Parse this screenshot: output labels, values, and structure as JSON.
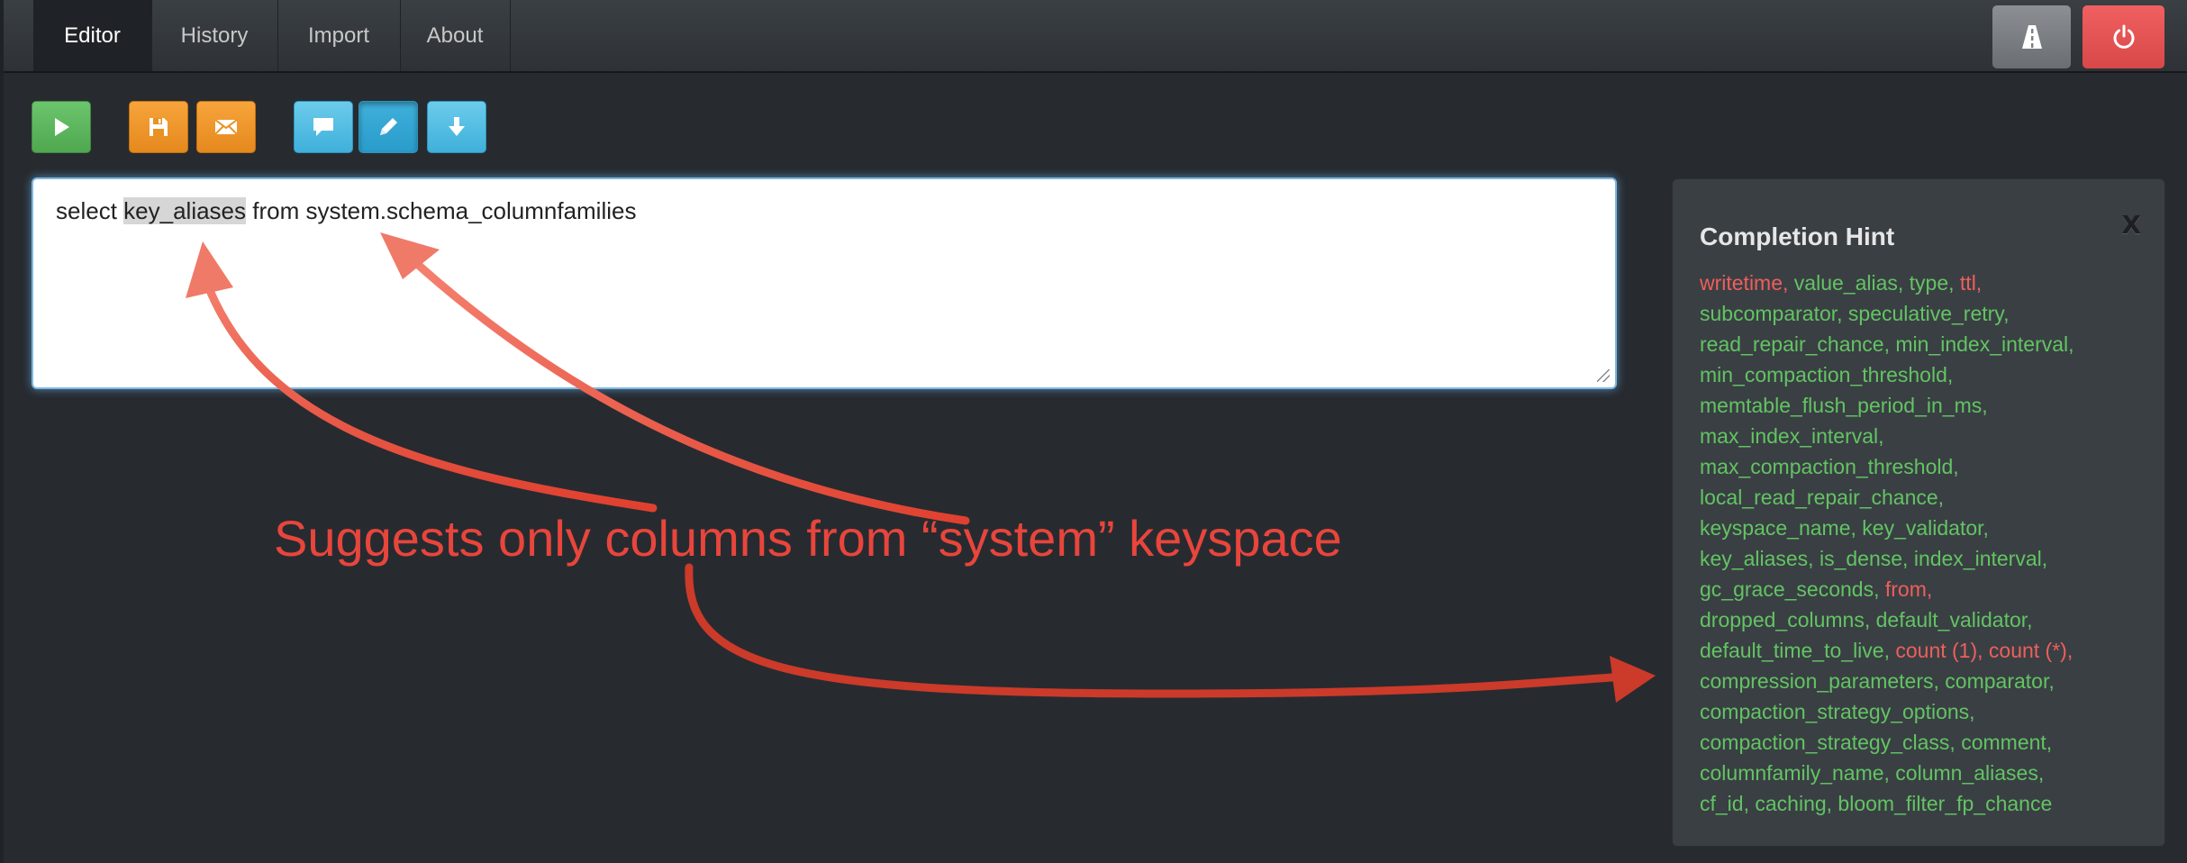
{
  "nav": {
    "tabs": [
      "Editor",
      "History",
      "Import",
      "About"
    ],
    "active_tab": "Editor"
  },
  "toolbar": {
    "buttons": [
      {
        "name": "run",
        "icon": "play-icon",
        "color": "green"
      },
      {
        "name": "save",
        "icon": "save-icon",
        "color": "orange"
      },
      {
        "name": "mail",
        "icon": "envelope-icon",
        "color": "orange"
      },
      {
        "name": "comment",
        "icon": "comment-icon",
        "color": "blue"
      },
      {
        "name": "edit",
        "icon": "pencil-icon",
        "color": "blue",
        "active": true
      },
      {
        "name": "download",
        "icon": "arrow-down-icon",
        "color": "blue"
      }
    ]
  },
  "editor": {
    "before": "select ",
    "highlight": "key_aliases",
    "after": " from system.schema_columnfamilies"
  },
  "completion": {
    "title": "Completion Hint",
    "close": "X",
    "lines": [
      [
        {
          "t": "writetime,",
          "k": true
        },
        {
          "t": " value_alias,",
          "k": false
        },
        {
          "t": " type,",
          "k": false
        },
        {
          "t": " ttl,",
          "k": true
        }
      ],
      [
        {
          "t": "subcomparator,",
          "k": false
        },
        {
          "t": " speculative_retry,",
          "k": false
        }
      ],
      [
        {
          "t": "read_repair_chance,",
          "k": false
        },
        {
          "t": " min_index_interval,",
          "k": false
        }
      ],
      [
        {
          "t": "min_compaction_threshold,",
          "k": false
        }
      ],
      [
        {
          "t": "memtable_flush_period_in_ms,",
          "k": false
        }
      ],
      [
        {
          "t": "max_index_interval,",
          "k": false
        }
      ],
      [
        {
          "t": "max_compaction_threshold,",
          "k": false
        }
      ],
      [
        {
          "t": "local_read_repair_chance,",
          "k": false
        }
      ],
      [
        {
          "t": "keyspace_name,",
          "k": false
        },
        {
          "t": " key_validator,",
          "k": false
        }
      ],
      [
        {
          "t": "key_aliases,",
          "k": false
        },
        {
          "t": " is_dense,",
          "k": false
        },
        {
          "t": " index_interval,",
          "k": false
        }
      ],
      [
        {
          "t": "gc_grace_seconds,",
          "k": false
        },
        {
          "t": " from,",
          "k": true
        }
      ],
      [
        {
          "t": "dropped_columns,",
          "k": false
        },
        {
          "t": " default_validator,",
          "k": false
        }
      ],
      [
        {
          "t": "default_time_to_live,",
          "k": false
        },
        {
          "t": " count (1),",
          "k": true
        },
        {
          "t": " count (*),",
          "k": true
        }
      ],
      [
        {
          "t": "compression_parameters,",
          "k": false
        },
        {
          "t": " comparator,",
          "k": false
        }
      ],
      [
        {
          "t": "compaction_strategy_options,",
          "k": false
        }
      ],
      [
        {
          "t": "compaction_strategy_class,",
          "k": false
        },
        {
          "t": " comment,",
          "k": false
        }
      ],
      [
        {
          "t": "columnfamily_name,",
          "k": false
        },
        {
          "t": " column_aliases,",
          "k": false
        }
      ],
      [
        {
          "t": "cf_id,",
          "k": false
        },
        {
          "t": " caching,",
          "k": false
        },
        {
          "t": " bloom_filter_fp_chance",
          "k": false
        }
      ]
    ]
  },
  "annotation": {
    "text": "Suggests only columns from “system” keyspace",
    "color": "#e8453c"
  },
  "colors": {
    "background": "#272b30",
    "hint_column": "#62c462",
    "hint_keyword": "#ee5f5b"
  }
}
